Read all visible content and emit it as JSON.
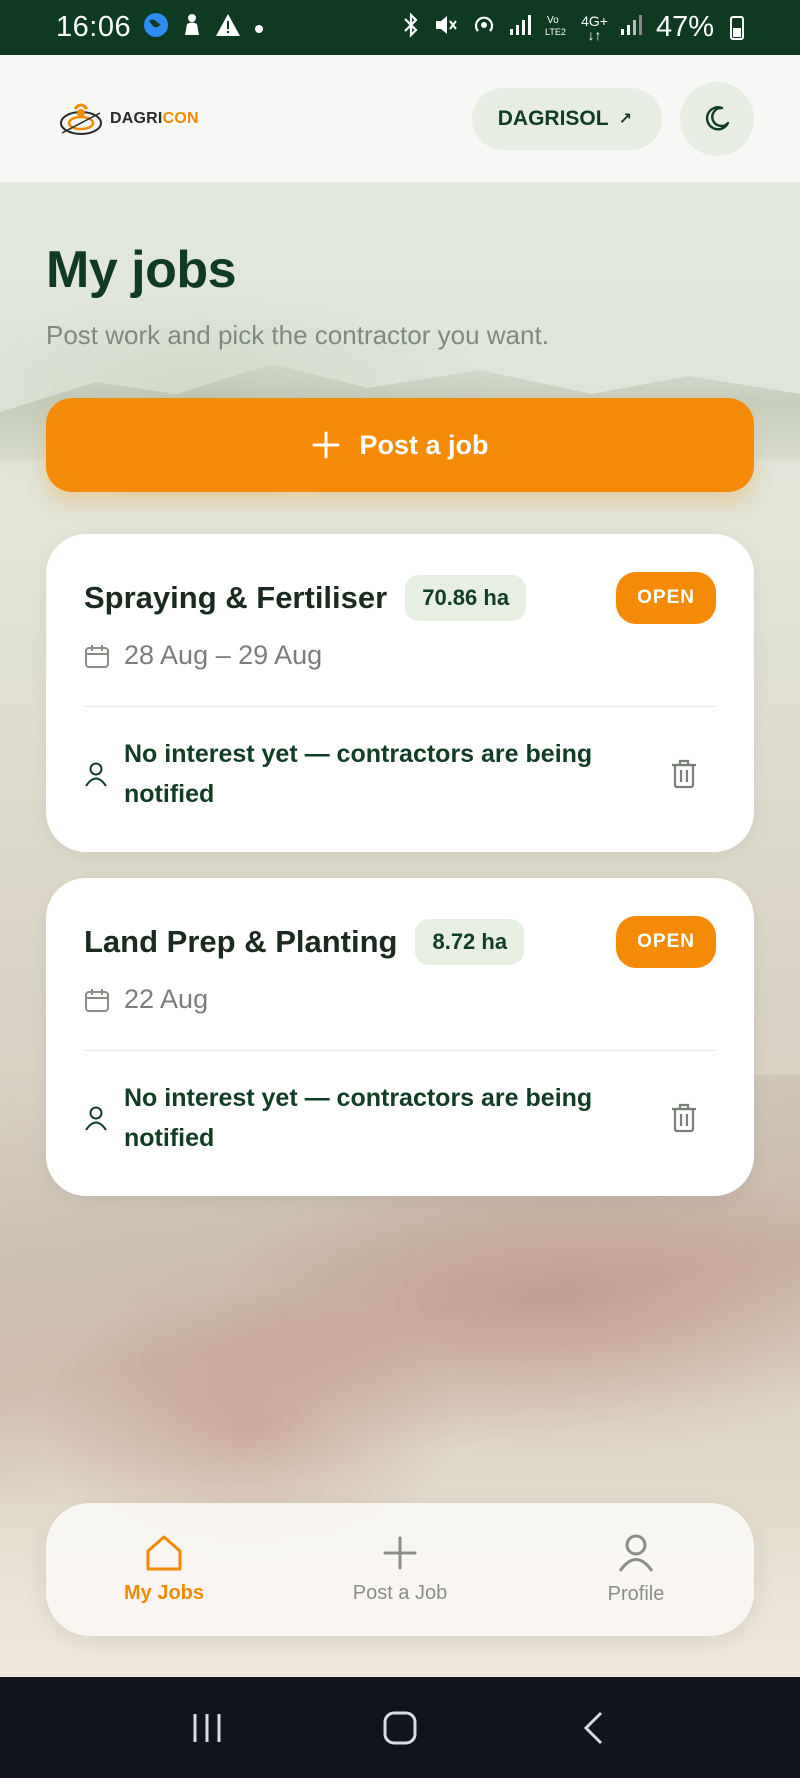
{
  "status_bar": {
    "time": "16:06",
    "battery": "47%",
    "network": "4G+",
    "left_icons": [
      "world-icon",
      "person-icon",
      "warning-icon",
      "dot-icon"
    ],
    "right_icons": [
      "bluetooth-icon",
      "mute-icon",
      "hotspot-icon",
      "signal-icon",
      "volte-icon",
      "signal-icon",
      "battery-icon"
    ]
  },
  "header": {
    "logo_text_prefix": "DAGRI",
    "logo_text_suffix": "CON",
    "org_label": "DAGRISOL",
    "org_arrow": "↗",
    "theme_icon": "moon-icon"
  },
  "page": {
    "title": "My jobs",
    "subtitle": "Post work and pick the contractor you want.",
    "post_button_label": "Post a job"
  },
  "jobs": [
    {
      "title": "Spraying & Fertiliser",
      "area": "70.86 ha",
      "status": "OPEN",
      "dates": "28 Aug – 29 Aug",
      "interest": "No interest yet — contractors are being notified"
    },
    {
      "title": "Land Prep & Planting",
      "area": "8.72 ha",
      "status": "OPEN",
      "dates": "22 Aug",
      "interest": "No interest yet — contractors are being notified"
    }
  ],
  "bottom_nav": {
    "items": [
      {
        "label": "My Jobs",
        "icon": "home-icon",
        "active": true
      },
      {
        "label": "Post a Job",
        "icon": "plus-icon",
        "active": false
      },
      {
        "label": "Profile",
        "icon": "user-icon",
        "active": false
      }
    ]
  },
  "colors": {
    "brand_green": "#123d25",
    "accent_orange": "#f58a07",
    "status_bar": "#0f3a22"
  }
}
